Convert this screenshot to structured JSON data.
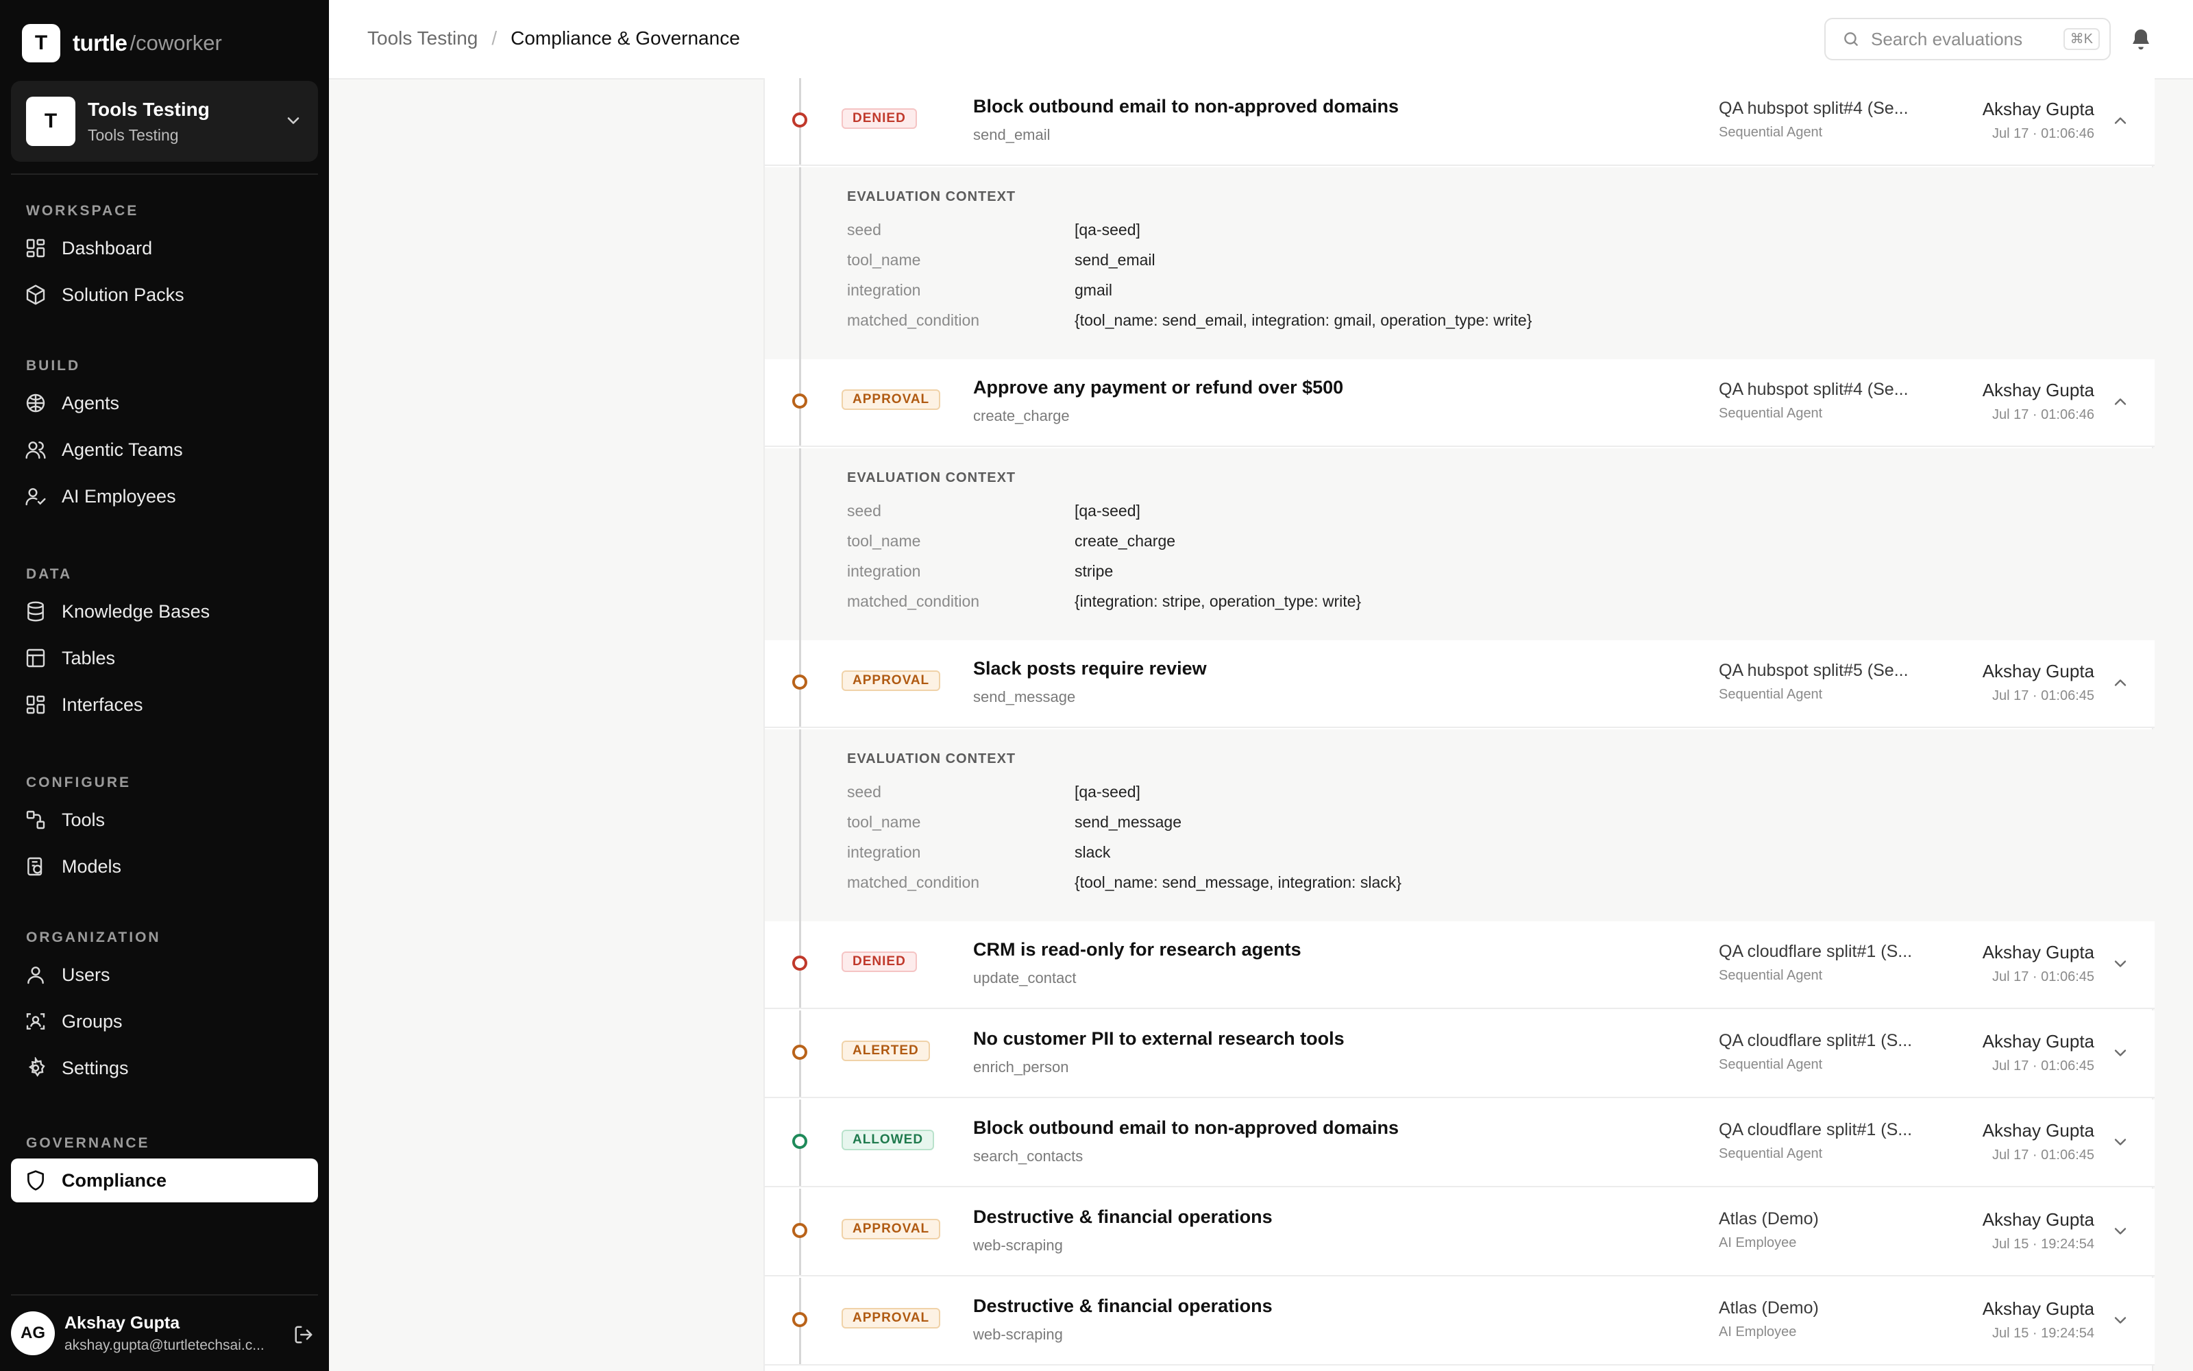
{
  "brand": {
    "logo": "T",
    "name": "turtle",
    "sub": "/coworker"
  },
  "workspace": {
    "avatar": "T",
    "title": "Tools Testing",
    "subtitle": "Tools Testing"
  },
  "nav": {
    "workspace": {
      "label": "WORKSPACE",
      "items": [
        "Dashboard",
        "Solution Packs"
      ]
    },
    "build": {
      "label": "BUILD",
      "items": [
        "Agents",
        "Agentic Teams",
        "AI Employees"
      ]
    },
    "data": {
      "label": "DATA",
      "items": [
        "Knowledge Bases",
        "Tables",
        "Interfaces"
      ]
    },
    "configure": {
      "label": "CONFIGURE",
      "items": [
        "Tools",
        "Models"
      ]
    },
    "organization": {
      "label": "ORGANIZATION",
      "items": [
        "Users",
        "Groups",
        "Settings"
      ]
    },
    "governance": {
      "label": "GOVERNANCE",
      "items": [
        "Compliance"
      ]
    }
  },
  "user": {
    "initials": "AG",
    "name": "Akshay Gupta",
    "email": "akshay.gupta@turtletechsai.c..."
  },
  "breadcrumb": {
    "parent": "Tools Testing",
    "separator": "/",
    "current": "Compliance & Governance"
  },
  "search": {
    "placeholder": "Search evaluations",
    "shortcut": "⌘K"
  },
  "colors": {
    "denied": "#c0392b",
    "approval": "#b05a12",
    "allowed": "#1f7a4d",
    "sidebar_bg": "#0c0c0c"
  },
  "context_label": "EVALUATION CONTEXT",
  "context_keys": [
    "seed",
    "tool_name",
    "integration",
    "matched_condition"
  ],
  "rows": [
    {
      "status": "DENIED",
      "title": "Block outbound email to non-approved domains",
      "tool": "send_email",
      "agent": "QA hubspot split#4 (Se...",
      "agent_type": "Sequential Agent",
      "user": "Akshay Gupta",
      "time": "Jul 17 · 01:06:46",
      "context": [
        "[qa-seed]",
        "send_email",
        "gmail",
        "{tool_name: send_email, integration: gmail, operation_type: write}"
      ]
    },
    {
      "status": "APPROVAL",
      "title": "Approve any payment or refund over $500",
      "tool": "create_charge",
      "agent": "QA hubspot split#4 (Se...",
      "agent_type": "Sequential Agent",
      "user": "Akshay Gupta",
      "time": "Jul 17 · 01:06:46",
      "context": [
        "[qa-seed]",
        "create_charge",
        "stripe",
        "{integration: stripe, operation_type: write}"
      ]
    },
    {
      "status": "APPROVAL",
      "title": "Slack posts require review",
      "tool": "send_message",
      "agent": "QA hubspot split#5 (Se...",
      "agent_type": "Sequential Agent",
      "user": "Akshay Gupta",
      "time": "Jul 17 · 01:06:45",
      "context": [
        "[qa-seed]",
        "send_message",
        "slack",
        "{tool_name: send_message, integration: slack}"
      ]
    },
    {
      "status": "DENIED",
      "title": "CRM is read-only for research agents",
      "tool": "update_contact",
      "agent": "QA cloudflare split#1 (S...",
      "agent_type": "Sequential Agent",
      "user": "Akshay Gupta",
      "time": "Jul 17 · 01:06:45"
    },
    {
      "status": "ALERTED",
      "title": "No customer PII to external research tools",
      "tool": "enrich_person",
      "agent": "QA cloudflare split#1 (S...",
      "agent_type": "Sequential Agent",
      "user": "Akshay Gupta",
      "time": "Jul 17 · 01:06:45"
    },
    {
      "status": "ALLOWED",
      "title": "Block outbound email to non-approved domains",
      "tool": "search_contacts",
      "agent": "QA cloudflare split#1 (S...",
      "agent_type": "Sequential Agent",
      "user": "Akshay Gupta",
      "time": "Jul 17 · 01:06:45"
    },
    {
      "status": "APPROVAL",
      "title": "Destructive & financial operations",
      "tool": "web-scraping",
      "agent": "Atlas (Demo)",
      "agent_type": "AI Employee",
      "user": "Akshay Gupta",
      "time": "Jul 15 · 19:24:54"
    },
    {
      "status": "APPROVAL",
      "title": "Destructive & financial operations",
      "tool": "web-scraping",
      "agent": "Atlas (Demo)",
      "agent_type": "AI Employee",
      "user": "Akshay Gupta",
      "time": "Jul 15 · 19:24:54"
    }
  ]
}
